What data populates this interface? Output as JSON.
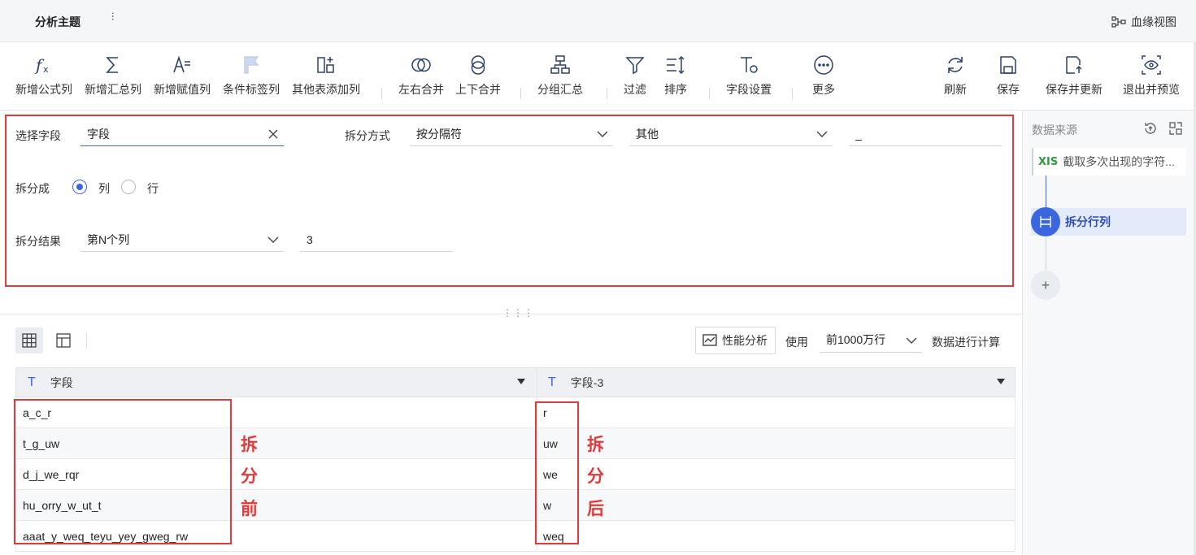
{
  "header": {
    "title": "分析主题",
    "lineage_label": "血缘视图"
  },
  "toolbar": {
    "add_formula": "新增公式列",
    "add_summary": "新增汇总列",
    "add_assign": "新增赋值列",
    "add_condition_tag": "条件标签列",
    "add_from_other": "其他表添加列",
    "merge_lr": "左右合并",
    "merge_tb": "上下合并",
    "group_summary": "分组汇总",
    "filter": "过滤",
    "sort": "排序",
    "field_settings": "字段设置",
    "more": "更多",
    "refresh": "刷新",
    "save": "保存",
    "save_update": "保存并更新",
    "exit_preview": "退出并预览"
  },
  "form": {
    "select_field_label": "选择字段",
    "select_field_value": "字段",
    "split_method_label": "拆分方式",
    "split_method_value": "按分隔符",
    "delimiter_type_value": "其他",
    "delimiter_value": "_",
    "split_into_label": "拆分成",
    "option_column": "列",
    "option_row": "行",
    "split_result_label": "拆分结果",
    "split_result_value": "第N个列",
    "n_value": "3"
  },
  "preview": {
    "perf_label": "性能分析",
    "use_label": "使用",
    "rows_option": "前1000万行",
    "compute_label": "数据进行计算"
  },
  "table": {
    "columns": [
      "字段",
      "字段-3"
    ],
    "rows": [
      [
        "a_c_r",
        "r"
      ],
      [
        "t_g_uw",
        "uw"
      ],
      [
        "d_j_we_rqr",
        "we"
      ],
      [
        "hu_orry_w_ut_t",
        "w"
      ],
      [
        "aaat_y_weq_teyu_yey_gweg_rw",
        "weq"
      ]
    ]
  },
  "annotations": {
    "before": [
      "拆",
      "分",
      "前"
    ],
    "after": [
      "拆",
      "分",
      "后"
    ],
    "color": "#e03a3a"
  },
  "right_panel": {
    "title": "数据来源",
    "source_icon_text": "XIS",
    "source_label": "截取多次出现的字符...",
    "step_label": "拆分行列",
    "add_label": "+"
  },
  "colors": {
    "accent": "#3a66e0",
    "highlight": "#e03a3a"
  }
}
